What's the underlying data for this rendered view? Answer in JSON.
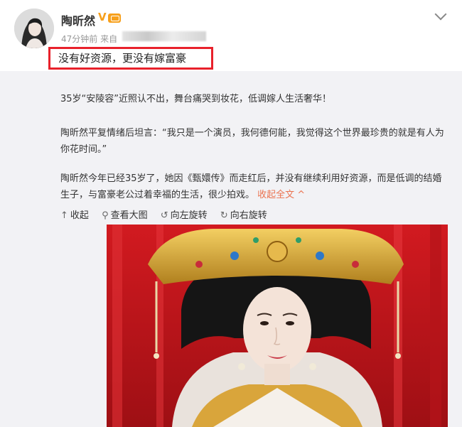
{
  "post": {
    "username": "陶昕然",
    "verified_mark": "V",
    "meta_time": "47分钟前 来自",
    "headline": "没有好资源，更没有嫁富豪"
  },
  "repost": {
    "paragraphs": [
      "35岁“安陵容”近照认不出，舞台痛哭到妆花，低调嫁人生活奢华！",
      "陶昕然平复情绪后坦言：“我只是一个演员，我何德何能，我觉得这个世界最珍贵的就是有人为你花时间。”",
      "陶昕然今年已经35岁了，她因《甄嬛传》而走红后，并没有继续利用好资源，而是低调的结婚生子，与富豪老公过着幸福的生活，很少拍戏。"
    ],
    "collapse_label": "收起全文 ^",
    "actions": {
      "collapse": "收起",
      "view_large": "查看大图",
      "rotate_left": "向左旋转",
      "rotate_right": "向右旋转"
    }
  },
  "colors": {
    "highlight": "#e8212b",
    "link": "#eb7350",
    "photo_bg": "#c81a1e",
    "badge": "#f7a01c"
  }
}
